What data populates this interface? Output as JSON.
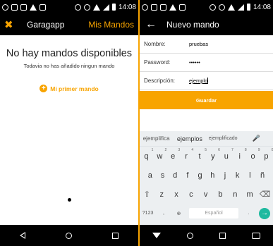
{
  "left": {
    "status_time": "14:08",
    "app_title": "Garagapp",
    "action_label": "Mis Mandos",
    "empty_title": "No hay mandos disponibles",
    "empty_subtitle": "Todavia no has añadido ningun mando",
    "add_first_label": "Mi primer mando"
  },
  "right": {
    "status_time": "14:08",
    "title": "Nuevo mando",
    "form": {
      "name_label": "Nombre:",
      "name_value": "pruebas",
      "password_label": "Password:",
      "password_value": "••••••",
      "description_label": "Descripción:",
      "description_value": "ejemplo"
    },
    "save_label": "Guardar",
    "keyboard": {
      "suggestions": [
        "ejemplifica",
        "ejemplos",
        "ejemplificado"
      ],
      "row1": [
        {
          "k": "q",
          "n": "1"
        },
        {
          "k": "w",
          "n": "2"
        },
        {
          "k": "e",
          "n": "3"
        },
        {
          "k": "r",
          "n": "4"
        },
        {
          "k": "t",
          "n": "5"
        },
        {
          "k": "y",
          "n": "6"
        },
        {
          "k": "u",
          "n": "7"
        },
        {
          "k": "i",
          "n": "8"
        },
        {
          "k": "o",
          "n": "9"
        },
        {
          "k": "p",
          "n": "0"
        }
      ],
      "row2": [
        "a",
        "s",
        "d",
        "f",
        "g",
        "h",
        "j",
        "k",
        "l",
        "ñ"
      ],
      "row3": [
        "z",
        "x",
        "c",
        "v",
        "b",
        "n",
        "m"
      ],
      "symbols_label": "?123",
      "comma": ",",
      "space_label": "Español",
      "period": "."
    }
  },
  "colors": {
    "accent": "#f8a400",
    "enter": "#1eb99f"
  }
}
